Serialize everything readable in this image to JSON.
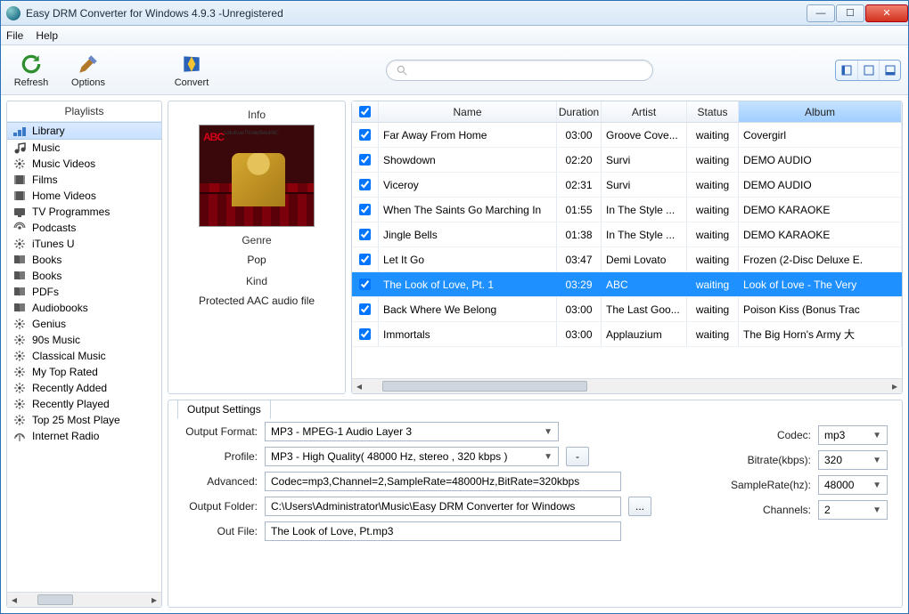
{
  "window": {
    "title": "Easy DRM Converter for Windows 4.9.3 -Unregistered"
  },
  "menu": {
    "file": "File",
    "help": "Help"
  },
  "toolbar": {
    "refresh": "Refresh",
    "options": "Options",
    "convert": "Convert"
  },
  "sidebar": {
    "title": "Playlists",
    "items": [
      "Library",
      "Music",
      "Music Videos",
      "Films",
      "Home Videos",
      "TV Programmes",
      "Podcasts",
      "iTunes U",
      "Books",
      "Books",
      "PDFs",
      "Audiobooks",
      "Genius",
      "90s Music",
      "Classical Music",
      "My Top Rated",
      "Recently Added",
      "Recently Played",
      "Top 25 Most Playe",
      "Internet Radio"
    ],
    "selected_index": 0
  },
  "info": {
    "title": "Info",
    "cover_text": "ABC",
    "cover_sub": "Look of Love\nThe Very Best of ABC",
    "genre_label": "Genre",
    "genre_value": "Pop",
    "kind_label": "Kind",
    "kind_value": "Protected AAC audio file"
  },
  "table": {
    "columns": {
      "name": "Name",
      "duration": "Duration",
      "artist": "Artist",
      "status": "Status",
      "album": "Album"
    },
    "selected_index": 6,
    "rows": [
      {
        "name": "Far Away From Home",
        "duration": "03:00",
        "artist": "Groove Cove...",
        "status": "waiting",
        "album": "Covergirl"
      },
      {
        "name": "Showdown",
        "duration": "02:20",
        "artist": "Survi",
        "status": "waiting",
        "album": "DEMO AUDIO"
      },
      {
        "name": "Viceroy",
        "duration": "02:31",
        "artist": "Survi",
        "status": "waiting",
        "album": "DEMO AUDIO"
      },
      {
        "name": "When The Saints Go Marching In",
        "duration": "01:55",
        "artist": "In The Style ...",
        "status": "waiting",
        "album": "DEMO KARAOKE"
      },
      {
        "name": "Jingle Bells",
        "duration": "01:38",
        "artist": "In The Style ...",
        "status": "waiting",
        "album": "DEMO KARAOKE"
      },
      {
        "name": "Let It Go",
        "duration": "03:47",
        "artist": "Demi Lovato",
        "status": "waiting",
        "album": "Frozen (2-Disc Deluxe E."
      },
      {
        "name": "The Look of Love, Pt. 1",
        "duration": "03:29",
        "artist": "ABC",
        "status": "waiting",
        "album": "Look of Love - The Very"
      },
      {
        "name": "Back Where We Belong",
        "duration": "03:00",
        "artist": "The Last Goo...",
        "status": "waiting",
        "album": "Poison Kiss (Bonus Trac"
      },
      {
        "name": "Immortals",
        "duration": "03:00",
        "artist": "Applauzium",
        "status": "waiting",
        "album": "The Big Horn's Army 大"
      }
    ]
  },
  "output": {
    "group_title": "Output Settings",
    "format_label": "Output Format:",
    "format_value": "MP3 - MPEG-1 Audio Layer 3",
    "profile_label": "Profile:",
    "profile_value": "MP3 - High Quality( 48000 Hz, stereo , 320 kbps  )",
    "advanced_label": "Advanced:",
    "advanced_value": "Codec=mp3,Channel=2,SampleRate=48000Hz,BitRate=320kbps",
    "folder_label": "Output Folder:",
    "folder_value": "C:\\Users\\Administrator\\Music\\Easy DRM Converter for Windows",
    "outfile_label": "Out File:",
    "outfile_value": "The Look of Love, Pt.mp3",
    "codec_label": "Codec:",
    "codec_value": "mp3",
    "bitrate_label": "Bitrate(kbps):",
    "bitrate_value": "320",
    "samplerate_label": "SampleRate(hz):",
    "samplerate_value": "48000",
    "channels_label": "Channels:",
    "channels_value": "2",
    "ellipsis": "...",
    "dash": "-"
  }
}
